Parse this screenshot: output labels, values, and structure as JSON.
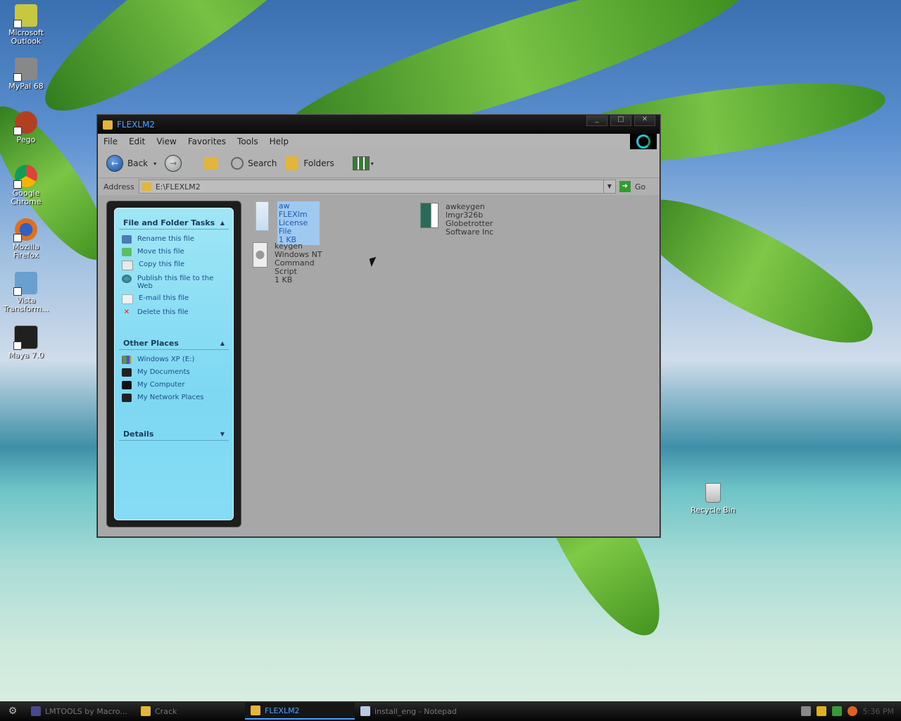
{
  "desktop": {
    "icons": [
      {
        "label": "Microsoft Outlook",
        "color": "#c8c840"
      },
      {
        "label": "MyPal 68",
        "color": "#888888"
      },
      {
        "label": "Pego",
        "color": "#b04020"
      },
      {
        "label": "Google Chrome",
        "color": "#db4437"
      },
      {
        "label": "Mozilla Firefox",
        "color": "#e07020"
      },
      {
        "label": "Vista Transform...",
        "color": "#6aa0d0"
      },
      {
        "label": "Maya 7.0",
        "color": "#202020"
      }
    ],
    "recycle_bin": "Recycle Bin"
  },
  "window": {
    "title": "FLEXLM2",
    "controls": [
      "_",
      "□",
      "✕"
    ],
    "menu": [
      "File",
      "Edit",
      "View",
      "Favorites",
      "Tools",
      "Help"
    ],
    "toolbar": {
      "back": "Back",
      "search": "Search",
      "folders": "Folders"
    },
    "address": {
      "label": "Address",
      "path": "E:\\FLEXLM2",
      "go": "Go"
    },
    "taskpane": {
      "file_tasks": {
        "title": "File and Folder Tasks",
        "items": [
          {
            "label": "Rename this file",
            "icon": "rename-icon"
          },
          {
            "label": "Move this file",
            "icon": "move-icon"
          },
          {
            "label": "Copy this file",
            "icon": "copy-icon"
          },
          {
            "label": "Publish this file to the Web",
            "icon": "publish-icon"
          },
          {
            "label": "E-mail this file",
            "icon": "email-icon"
          },
          {
            "label": "Delete this file",
            "icon": "delete-icon"
          }
        ]
      },
      "other_places": {
        "title": "Other Places",
        "items": [
          {
            "label": "Windows XP (E:)",
            "icon": "drive-icon"
          },
          {
            "label": "My Documents",
            "icon": "documents-icon"
          },
          {
            "label": "My Computer",
            "icon": "computer-icon"
          },
          {
            "label": "My Network Places",
            "icon": "network-icon"
          }
        ]
      },
      "details": {
        "title": "Details"
      }
    },
    "files": [
      {
        "name": "aw",
        "type": "FLEXlm License File",
        "info": "1 KB",
        "selected": true
      },
      {
        "name": "awkeygen",
        "type": "lmgr326b",
        "info": "Globetrotter Software Inc",
        "selected": false
      },
      {
        "name": "keygen",
        "type": "Windows NT Command Script",
        "info": "1 KB",
        "selected": false
      }
    ]
  },
  "taskbar": {
    "items": [
      {
        "label": "LMTOOLS by Macro...",
        "active": false
      },
      {
        "label": "Crack",
        "active": false
      },
      {
        "label": "FLEXLM2",
        "active": true
      },
      {
        "label": "install_eng - Notepad",
        "active": false
      }
    ],
    "clock": "5:36 PM"
  }
}
